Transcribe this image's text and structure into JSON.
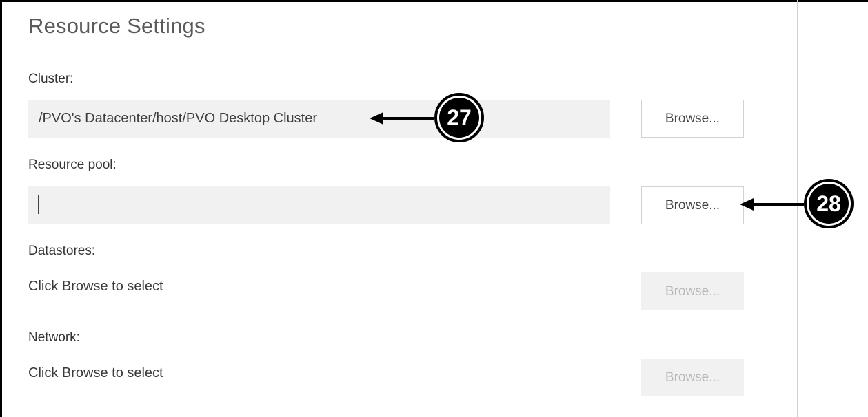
{
  "section": {
    "title": "Resource Settings"
  },
  "cluster": {
    "label": "Cluster:",
    "value": "/PVO's Datacenter/host/PVO Desktop Cluster",
    "browse_label": "Browse..."
  },
  "resource_pool": {
    "label": "Resource pool:",
    "value": "",
    "browse_label": "Browse..."
  },
  "datastores": {
    "label": "Datastores:",
    "hint": "Click Browse to select",
    "browse_label": "Browse..."
  },
  "network": {
    "label": "Network:",
    "hint": "Click Browse to select",
    "browse_label": "Browse..."
  },
  "callouts": {
    "cluster_marker": "27",
    "resource_pool_marker": "28"
  },
  "colors": {
    "field_bg": "#f1f1f1",
    "disabled_text": "#b9b9b9",
    "callout": "#000000"
  }
}
